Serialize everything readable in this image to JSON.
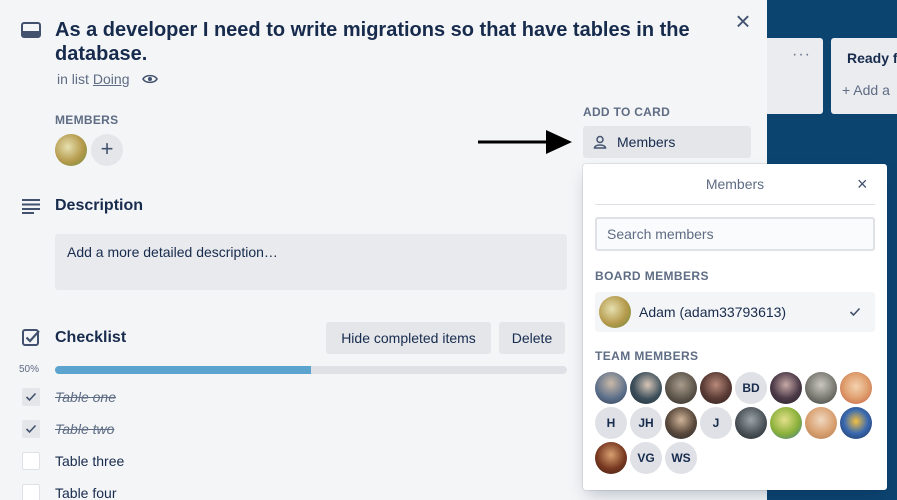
{
  "board": {
    "column1_menu": "···",
    "column2_title": "Ready f",
    "column2_add": "+ Add a"
  },
  "card": {
    "title": "As a developer I need to write migrations so that have tables in the database.",
    "in_list_prefix": "in list",
    "list_name": "Doing",
    "members_label": "MEMBERS",
    "add_member": "+",
    "close": "×"
  },
  "sidebar": {
    "add_to_card_label": "ADD TO CARD",
    "members_button": "Members"
  },
  "description": {
    "title": "Description",
    "placeholder": "Add a more detailed description…"
  },
  "checklist": {
    "title": "Checklist",
    "hide_button": "Hide completed items",
    "delete_button": "Delete",
    "percent_label": "50%",
    "progress": 0.5,
    "items": [
      {
        "label": "Table one",
        "done": true
      },
      {
        "label": "Table two",
        "done": true
      },
      {
        "label": "Table three",
        "done": false
      },
      {
        "label": "Table four",
        "done": false
      }
    ]
  },
  "popover": {
    "title": "Members",
    "close": "×",
    "search_placeholder": "Search members",
    "board_members_label": "BOARD MEMBERS",
    "board_member_name": "Adam (adam33793613)",
    "team_members_label": "TEAM MEMBERS",
    "team_initials": {
      "bd": "BD",
      "h": "H",
      "jh": "JH",
      "j": "J",
      "vg": "VG",
      "ws": "WS"
    }
  },
  "colors": {
    "accent": "#5ba4cf",
    "board_bg": "#0c4470",
    "modal_bg": "#f4f5f7"
  }
}
